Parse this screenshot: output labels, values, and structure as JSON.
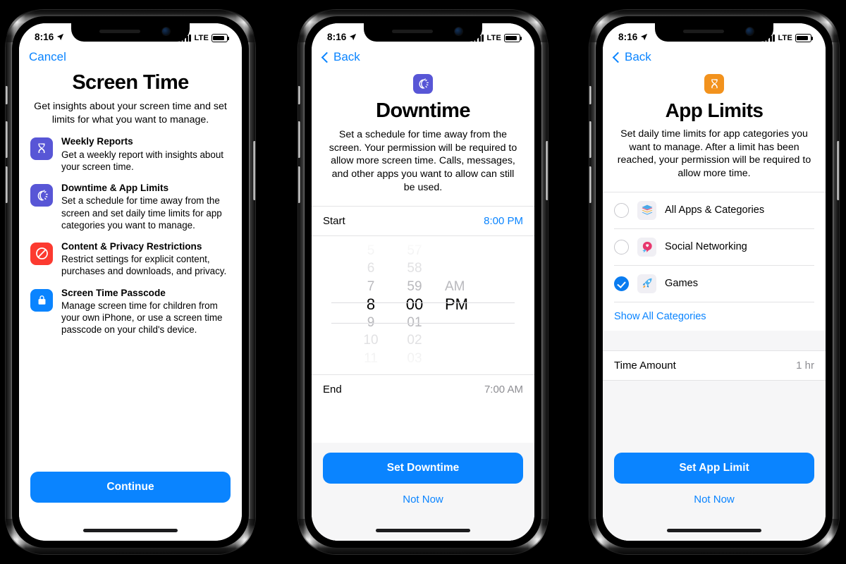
{
  "status_bar": {
    "time": "8:16",
    "location_icon": "location-arrow-icon",
    "signal_icon": "cellular-bars-icon",
    "network": "LTE",
    "battery_icon": "battery-icon"
  },
  "phones": [
    {
      "id": "screen-time-intro",
      "nav": {
        "label": "Cancel",
        "type": "cancel"
      },
      "title": "Screen Time",
      "subtitle": "Get insights about your screen time and set limits for what you want to manage.",
      "features": [
        {
          "icon": "hourglass-icon",
          "icon_color": "#5856d6",
          "title": "Weekly Reports",
          "desc": "Get a weekly report with insights about your screen time."
        },
        {
          "icon": "downtime-moon-icon",
          "icon_color": "#5856d6",
          "title": "Downtime & App Limits",
          "desc": "Set a schedule for time away from the screen and set daily time limits for app categories you want to manage."
        },
        {
          "icon": "no-entry-icon",
          "icon_color": "#fc3a30",
          "title": "Content & Privacy Restrictions",
          "desc": "Restrict settings for explicit content, purchases and downloads, and privacy."
        },
        {
          "icon": "lock-icon",
          "icon_color": "#0a84ff",
          "title": "Screen Time Passcode",
          "desc": "Manage screen time for children from your own iPhone, or use a screen time passcode on your child's device."
        }
      ],
      "primary_button": "Continue"
    },
    {
      "id": "downtime-setup",
      "nav": {
        "label": "Back",
        "type": "back"
      },
      "hero_icon": "downtime-moon-icon",
      "hero_icon_color": "#5856d6",
      "title": "Downtime",
      "subtitle": "Set a schedule for time away from the screen. Your permission will be required to allow more screen time. Calls, messages, and other apps you want to allow can still be used.",
      "start_row": {
        "label": "Start",
        "value": "8:00 PM"
      },
      "end_row": {
        "label": "End",
        "value": "7:00 AM"
      },
      "picker": {
        "hours": [
          "5",
          "6",
          "7",
          "8",
          "9",
          "10",
          "11"
        ],
        "minutes": [
          "57",
          "58",
          "59",
          "00",
          "01",
          "02",
          "03"
        ],
        "meridiem": [
          "AM",
          "PM"
        ],
        "selected_hour": "8",
        "selected_minute": "00",
        "selected_meridiem": "PM"
      },
      "primary_button": "Set Downtime",
      "secondary_button": "Not Now"
    },
    {
      "id": "app-limits-setup",
      "nav": {
        "label": "Back",
        "type": "back"
      },
      "hero_icon": "hourglass-icon",
      "hero_icon_color": "#f2921d",
      "title": "App Limits",
      "subtitle": "Set daily time limits for app categories you want to manage. After a limit has been reached, your permission will be required to allow more time.",
      "categories": [
        {
          "label": "All Apps & Categories",
          "icon": "all-apps-stack-icon",
          "selected": false
        },
        {
          "label": "Social Networking",
          "icon": "social-networking-icon",
          "selected": false
        },
        {
          "label": "Games",
          "icon": "games-rocket-icon",
          "selected": true
        }
      ],
      "show_all_link": "Show All Categories",
      "time_amount_row": {
        "label": "Time Amount",
        "value": "1 hr"
      },
      "primary_button": "Set App Limit",
      "secondary_button": "Not Now"
    }
  ]
}
